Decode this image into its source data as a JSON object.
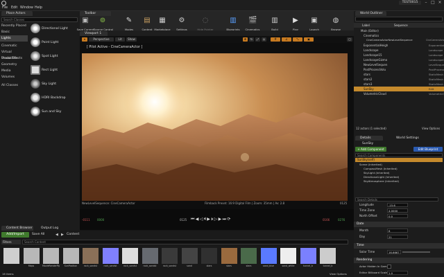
{
  "menu": {
    "items": [
      "File",
      "Edit",
      "Window",
      "Help"
    ],
    "project": "TEST0015"
  },
  "place_actors": {
    "tab": "Place Actors",
    "search_placeholder": "Search Classes",
    "categories": [
      "Recently Placed",
      "Basic",
      "Lights",
      "Cinematic",
      "Virtual Production",
      "Visual Effects",
      "Geometry",
      "Media",
      "Volumes",
      "All Classes"
    ],
    "selected_category": "Lights",
    "items": [
      {
        "label": "Directional Light",
        "icon": "directional-light-icon"
      },
      {
        "label": "Point Light",
        "icon": "point-light-icon"
      },
      {
        "label": "Spot Light",
        "icon": "spot-light-icon"
      },
      {
        "label": "Rect Light",
        "icon": "rect-light-icon"
      },
      {
        "label": "Sky Light",
        "icon": "sky-light-icon"
      },
      {
        "label": "HDRI Backdrop",
        "icon": "hdri-backdrop-icon"
      },
      {
        "label": "Sun and Sky",
        "icon": "sun-and-sky-icon"
      }
    ]
  },
  "toolbar": {
    "tab": "Toolbar",
    "buttons": [
      {
        "label": "Save Current",
        "icon": "save-icon"
      },
      {
        "label": "Source Control",
        "icon": "source-control-icon"
      },
      {
        "label": "Modes",
        "icon": "modes-icon"
      },
      {
        "label": "Content",
        "icon": "content-icon"
      },
      {
        "label": "Marketplace",
        "icon": "marketplace-icon"
      },
      {
        "label": "Settings",
        "icon": "settings-icon"
      },
      {
        "label": "Hide Pointer",
        "icon": "hide-pointer-icon"
      },
      {
        "label": "Blueprints",
        "icon": "blueprints-icon"
      },
      {
        "label": "Cinematics",
        "icon": "cinematics-icon"
      },
      {
        "label": "Build",
        "icon": "build-icon"
      },
      {
        "label": "Play",
        "icon": "play-icon"
      },
      {
        "label": "Launch",
        "icon": "launch-icon"
      },
      {
        "label": "Browse",
        "icon": "browse-icon"
      }
    ]
  },
  "viewport": {
    "tab": "Viewport 1",
    "view_mode": "Perspective",
    "lit": "Lit",
    "show": "Show",
    "pilot_label": "[ Pilot Active - CineCameraActor ]",
    "camera_name": "NewLevelSequence: CineCameraActor",
    "filmback": "Filmback Preset: 16:9 Digital Film | Zoom: 35mm | Av: 2.8",
    "frame_right": "0125",
    "seq_start": "-0111",
    "seq_start2": "0000",
    "seq_current": "0125",
    "seq_end": "0166",
    "seq_end2": "0276"
  },
  "outliner": {
    "tab": "World Outliner",
    "col_label": "Label",
    "col_type": "Sequence",
    "rows": [
      {
        "label": "Main (Editor)",
        "type": "",
        "indent": 0,
        "sel": false
      },
      {
        "label": "Cinematics",
        "type": "",
        "indent": 1,
        "sel": false
      },
      {
        "label": "CineCameraActorNewLevelSequence",
        "type": "CineCameraActor",
        "indent": 2,
        "sel": false
      },
      {
        "label": "ExponentialHeigh",
        "type": "Exponential",
        "indent": 1,
        "sel": false
      },
      {
        "label": "Landscape",
        "type": "Landscape",
        "indent": 1,
        "sel": false
      },
      {
        "label": "Landscape15",
        "type": "Landscape",
        "indent": 1,
        "sel": false
      },
      {
        "label": "LandscapeGizmo",
        "type": "LandscapeG",
        "indent": 1,
        "sel": false
      },
      {
        "label": "NewLevelSequen",
        "type": "LevelSequence",
        "indent": 1,
        "sel": false
      },
      {
        "label": "PostProcessVolu",
        "type": "PostProcess",
        "indent": 1,
        "sel": false
      },
      {
        "label": "stars",
        "type": "StaticMesh",
        "indent": 1,
        "sel": false
      },
      {
        "label": "stars2",
        "type": "StaticMesh",
        "indent": 1,
        "sel": false
      },
      {
        "label": "stars3",
        "type": "StaticMesh",
        "indent": 1,
        "sel": false
      },
      {
        "label": "SunSky",
        "type": "Edit SunSky",
        "indent": 1,
        "sel": true
      },
      {
        "label": "VolumetricCloud",
        "type": "VolumetricC",
        "indent": 1,
        "sel": false
      }
    ],
    "count": "12 actors (1 selected)",
    "view_options": "View Options"
  },
  "details": {
    "tab": "Details",
    "tab2": "World Settings",
    "actor": "SunSky",
    "add_component": "+ Add Component",
    "edit_blueprint": "Edit Blueprint",
    "search_placeholder": "Search Components",
    "root": "SunSky(self)",
    "components": [
      "Scene (Inherited)",
      "CompassMesh (Inherited)",
      "SkyLight (Inherited)",
      "DirectionalLight (Inherited)",
      "SkyAtmosphere (Inherited)"
    ],
    "search2": "Search Details",
    "props": [
      {
        "label": "Longitude",
        "value": "-15.6"
      },
      {
        "label": "Time Zone",
        "value": "4.0000"
      },
      {
        "label": "North Offset",
        "value": "0.0"
      }
    ],
    "date_section": "Date",
    "date_props": [
      {
        "label": "Month",
        "value": "6"
      },
      {
        "label": "Day",
        "value": "21"
      }
    ],
    "time_section": "Time",
    "time_props": [
      {
        "label": "Solar Time",
        "value": "16.6667"
      }
    ],
    "render_section": "Rendering",
    "render_props": [
      {
        "label": "Actor Hidden In Game",
        "value": ""
      },
      {
        "label": "Editor Billboard Scale",
        "value": "1.0"
      }
    ]
  },
  "content_browser": {
    "tab": "Content Browser",
    "tab2": "Output Log",
    "add_import": "Add/Import",
    "save_all": "Save All",
    "path": "Content",
    "filters": "Filters",
    "search_placeholder": "Search Content",
    "assets": [
      {
        "label": "",
        "color": "#cfcfcf"
      },
      {
        "label": "Maps",
        "color": "#b8b8b8"
      },
      {
        "label": "MovieRenderPip",
        "color": "#b8b8b8"
      },
      {
        "label": "SunPosition",
        "color": "#b8b8b8"
      },
      {
        "label": "rock_sandst",
        "color": "#8a7058"
      },
      {
        "label": "rock_sandst",
        "color": "#8080ff"
      },
      {
        "label": "rock_sandst",
        "color": "#dddddd"
      },
      {
        "label": "rock_sandst",
        "color": "#666a70"
      },
      {
        "label": "rock_sandst",
        "color": "#3a3a3a"
      },
      {
        "label": "sand",
        "color": "#444"
      },
      {
        "label": "stars",
        "color": "#303030"
      },
      {
        "label": "stars",
        "color": "#9a6a3e"
      },
      {
        "label": "stars",
        "color": "#4a6a4a"
      },
      {
        "label": "sand_blue",
        "color": "#5a7aff"
      },
      {
        "label": "sand_white",
        "color": "#eeeeee"
      },
      {
        "label": "tunnel_b",
        "color": "#7a80ff"
      },
      {
        "label": "tunnel_b",
        "color": "#cccccc"
      }
    ],
    "count": "16 items",
    "view_options": "View Options"
  }
}
